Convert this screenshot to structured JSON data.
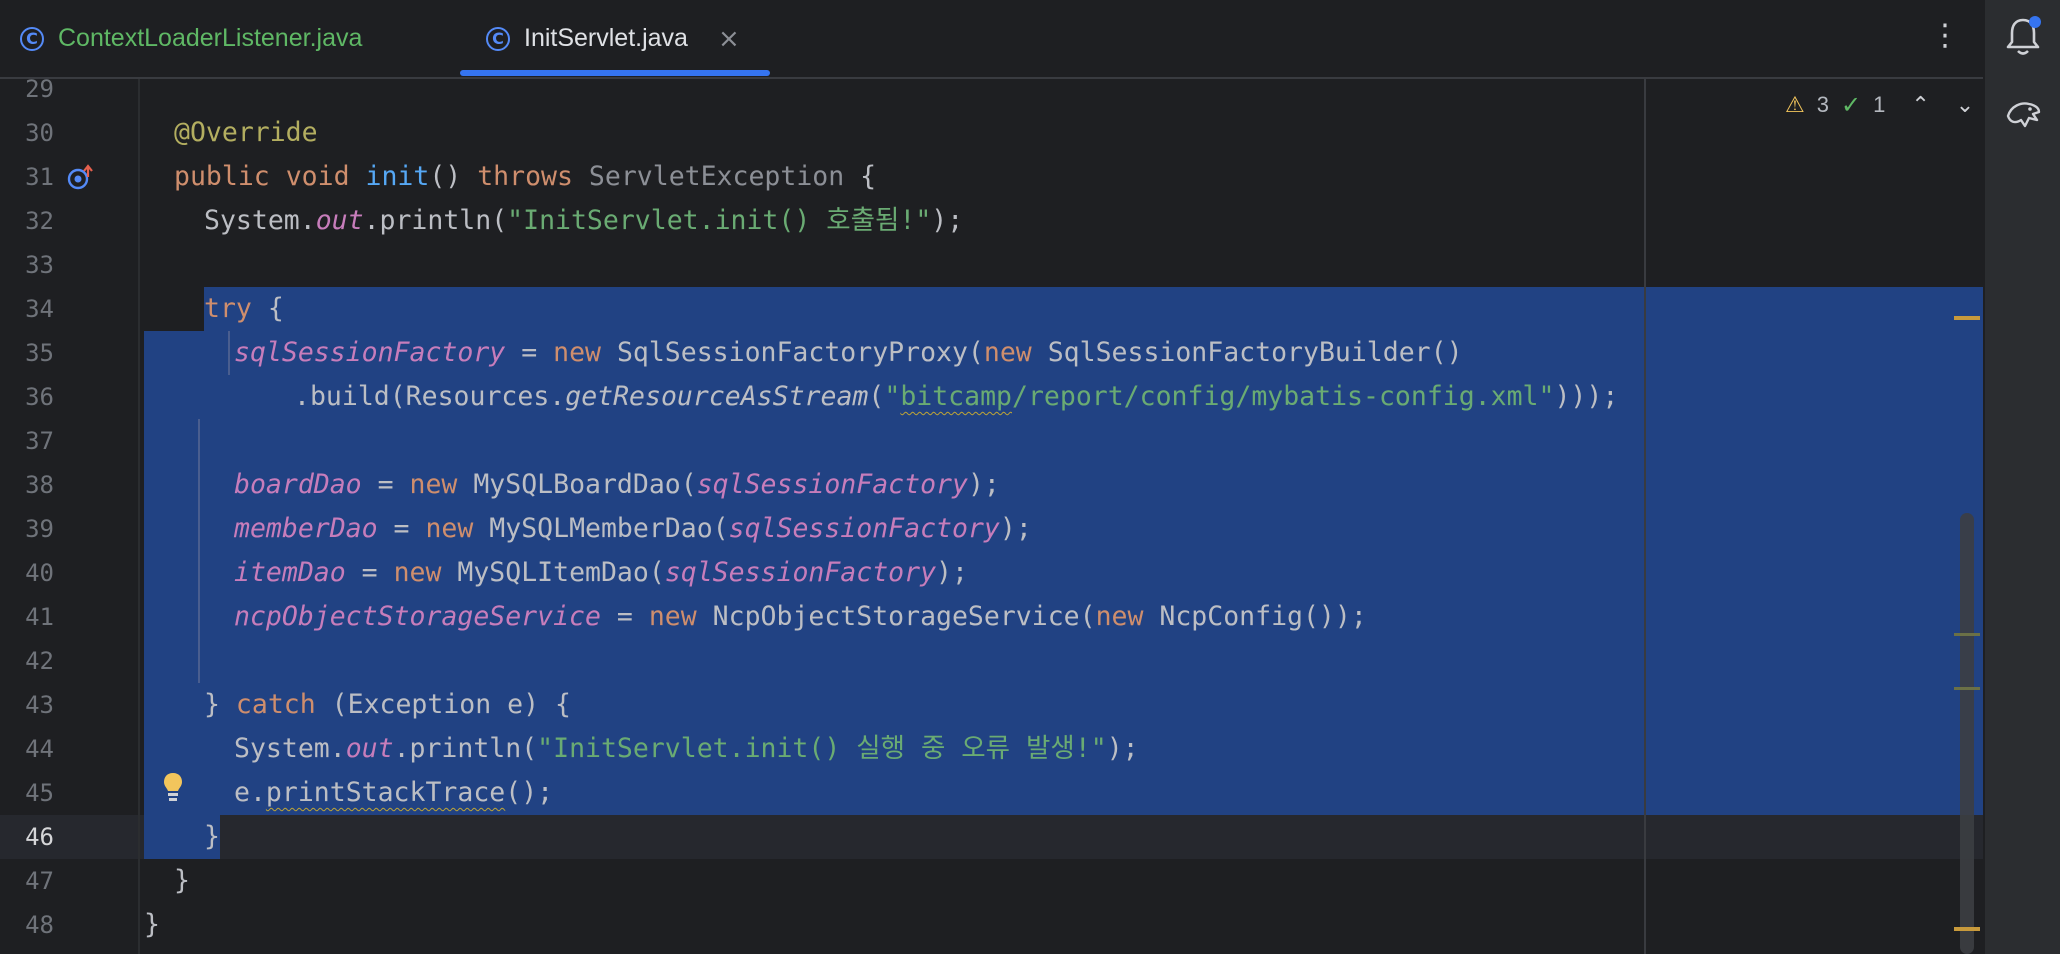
{
  "tabs": [
    {
      "label": "ContextLoaderListener.java",
      "icon": "class-icon",
      "active": false
    },
    {
      "label": "InitServlet.java",
      "icon": "class-icon",
      "active": true,
      "close": "×"
    }
  ],
  "more_menu": "⋮",
  "inspection": {
    "warnings": "3",
    "ok": "1",
    "warn_glyph": "⚠",
    "ok_glyph": "✓",
    "up": "⌃",
    "down": "⌄"
  },
  "line_numbers": [
    "29",
    "30",
    "31",
    "32",
    "33",
    "34",
    "35",
    "36",
    "37",
    "38",
    "39",
    "40",
    "41",
    "42",
    "43",
    "44",
    "45",
    "46",
    "47",
    "48"
  ],
  "current_line": "46",
  "colors": {
    "selection": "#214283",
    "keyword": "#cf8e6d",
    "string": "#6aab73",
    "field": "#c77dbb",
    "annotation": "#b3ae60",
    "method": "#56a8f5"
  },
  "code": {
    "l30_annotation": "@Override",
    "l31_public": "public",
    "l31_void": "void",
    "l31_init": "init",
    "l31_parens": "()",
    "l31_throws": "throws",
    "l31_exception": "ServletException",
    "l31_brace": "{",
    "l32_system": "System.",
    "l32_out": "out",
    "l32_println": ".println(",
    "l32_string": "\"InitServlet.init() 호출됨!\"",
    "l32_end": ");",
    "l34_try": "try",
    "l34_brace": " {",
    "l35_field": "sqlSessionFactory",
    "l35_eq": " = ",
    "l35_new1": "new",
    "l35_proxy": " SqlSessionFactoryProxy(",
    "l35_new2": "new",
    "l35_builder": " SqlSessionFactoryBuilder()",
    "l36_build": ".build(Resources.",
    "l36_getres": "getResourceAsStream",
    "l36_paren": "(",
    "l36_q": "\"",
    "l36_bitcamp": "bitcamp",
    "l36_path": "/report/config/mybatis-config.xml\"",
    "l36_end": ")));",
    "l38_field": "boardDao",
    "l38_eq": " = ",
    "l38_new": "new",
    "l38_cls": " MySQLBoardDao(",
    "l38_arg": "sqlSessionFactory",
    "l38_end": ");",
    "l39_field": "memberDao",
    "l39_eq": " = ",
    "l39_new": "new",
    "l39_cls": " MySQLMemberDao(",
    "l39_arg": "sqlSessionFactory",
    "l39_end": ");",
    "l40_field": "itemDao",
    "l40_eq": " = ",
    "l40_new": "new",
    "l40_cls": " MySQLItemDao(",
    "l40_arg": "sqlSessionFactory",
    "l40_end": ");",
    "l41_field": "ncpObjectStorageService",
    "l41_eq": " = ",
    "l41_new1": "new",
    "l41_cls": " NcpObjectStorageService(",
    "l41_new2": "new",
    "l41_cfg": " NcpConfig());",
    "l43_close": "} ",
    "l43_catch": "catch",
    "l43_rest": " (Exception e) {",
    "l44_system": "System.",
    "l44_out": "out",
    "l44_println": ".println(",
    "l44_string": "\"InitServlet.init() 실행 중 오류 발생!\"",
    "l44_end": ");",
    "l45_e": "e.",
    "l45_method": "printStackTrace",
    "l45_end": "();",
    "l46_brace": "}",
    "l47_brace": "}",
    "l48_brace": "}"
  }
}
